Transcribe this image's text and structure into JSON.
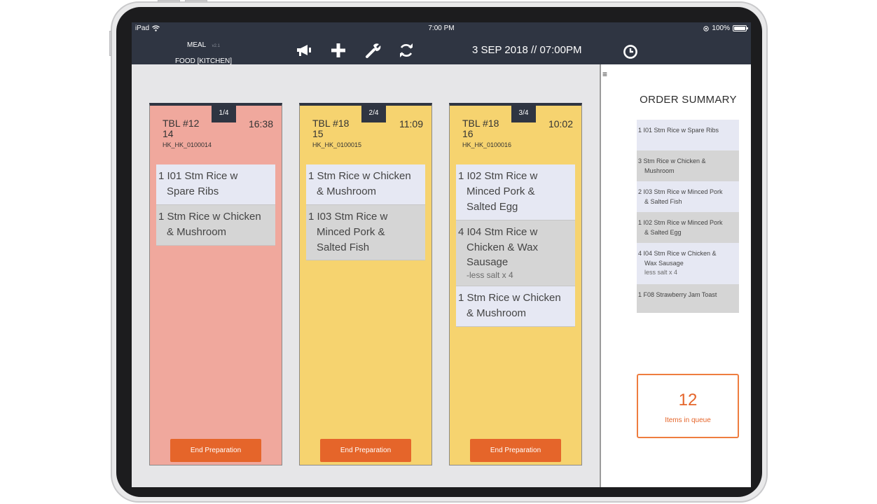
{
  "status_bar": {
    "device": "iPad",
    "time": "7:00 PM",
    "battery": "100%"
  },
  "header": {
    "app_name": "MEAL",
    "version": "v2.1",
    "station": "FOOD [KITCHEN]",
    "datetime": "3 SEP 2018 // 07:00PM",
    "icons": [
      "megaphone-icon",
      "plus-icon",
      "wrench-icon",
      "refresh-icon",
      "clock-icon"
    ]
  },
  "tickets": [
    {
      "badge": "1/4",
      "table": "TBL #12",
      "table_sub": "14",
      "time": "16:38",
      "ref": "HK_HK_0100014",
      "color": "#f0a89d",
      "items": [
        {
          "line1": "1 I01 Stm Rice w",
          "line2": "Spare Ribs",
          "line3": "",
          "note": ""
        },
        {
          "line1": "1 Stm Rice w Chicken",
          "line2": "& Mushroom",
          "line3": "",
          "note": ""
        }
      ],
      "button": "End Preparation"
    },
    {
      "badge": "2/4",
      "table": "TBL #18",
      "table_sub": "15",
      "time": "11:09",
      "ref": "HK_HK_0100015",
      "color": "#f6d36f",
      "items": [
        {
          "line1": "1 Stm Rice w Chicken",
          "line2": "& Mushroom",
          "line3": "",
          "note": ""
        },
        {
          "line1": "1 I03 Stm Rice w",
          "line2": "Minced Pork &",
          "line3": "Salted Fish",
          "note": ""
        }
      ],
      "button": "End Preparation"
    },
    {
      "badge": "3/4",
      "table": "TBL #18",
      "table_sub": "16",
      "time": "10:02",
      "ref": "HK_HK_0100016",
      "color": "#f6d36f",
      "items": [
        {
          "line1": "1 I02 Stm Rice w",
          "line2": "Minced Pork &",
          "line3": "Salted Egg",
          "note": ""
        },
        {
          "line1": "4 I04 Stm Rice w",
          "line2": "Chicken & Wax",
          "line3": "Sausage",
          "note": "-less salt x 4"
        },
        {
          "line1": "1 Stm Rice w Chicken",
          "line2": "& Mushroom",
          "line3": "",
          "note": ""
        }
      ],
      "button": "End Preparation"
    }
  ],
  "summary": {
    "title": "ORDER SUMMARY",
    "items": [
      {
        "line1": "1 I01 Stm Rice w Spare Ribs",
        "line2": "",
        "note": ""
      },
      {
        "line1": "3 Stm Rice w Chicken &",
        "line2": "Mushroom",
        "note": ""
      },
      {
        "line1": "2 I03 Stm Rice w Minced Pork",
        "line2": "& Salted Fish",
        "note": ""
      },
      {
        "line1": "1 I02 Stm Rice w Minced Pork",
        "line2": "& Salted Egg",
        "note": ""
      },
      {
        "line1": "4 I04 Stm Rice w Chicken &",
        "line2": "Wax Sausage",
        "note": "less salt x 4"
      },
      {
        "line1": "1 F08 Strawberry Jam Toast",
        "line2": "",
        "note": ""
      }
    ],
    "queue_count": "12",
    "queue_label": "Items in queue"
  },
  "colors": {
    "header": "#2f3542",
    "accent": "#e5652a",
    "ticket_red": "#f0a89d",
    "ticket_yellow": "#f6d36f"
  }
}
